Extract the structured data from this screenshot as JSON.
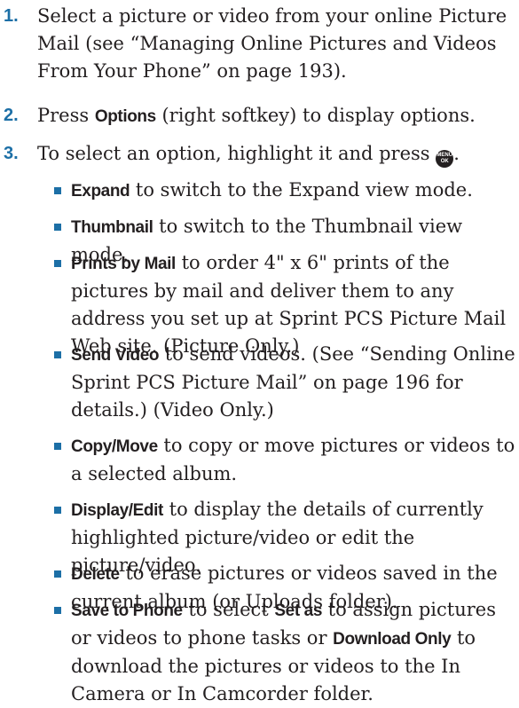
{
  "colors": {
    "accent": "#1c6fa6",
    "text": "#231f20"
  },
  "steps": [
    {
      "num": "1.",
      "text": "Select a picture or video from your online Picture Mail (see “Managing Online Pictures and Videos From Your Phone” on page 193)."
    },
    {
      "num": "2.",
      "bold": "Options",
      "rest": " (right softkey) to display options.",
      "pre": "Press "
    },
    {
      "num": "3.",
      "text": "To select an option, highlight it and press ",
      "key_icon": "menu-ok-key-icon",
      "key_top": "MENU",
      "key_bottom": "OK",
      "end": "."
    }
  ],
  "options": [
    {
      "bold": "Expand",
      "text": " to switch to the Expand view mode."
    },
    {
      "bold": "Thumbnail",
      "text": " to switch to the Thumbnail view mode."
    },
    {
      "bold": "Prints by Mail",
      "text": " to order 4\" x 6\" prints of the pictures by mail and deliver them to any address you set up at Sprint PCS Picture Mail Web site. (Picture Only.)"
    },
    {
      "bold": "Send Video",
      "text": " to send videos. (See “Sending Online Sprint PCS Picture Mail” on page 196 for details.) (Video Only.)"
    },
    {
      "bold": "Copy/Move",
      "text": " to copy or move pictures or videos to a selected album."
    },
    {
      "bold": "Display/Edit",
      "text": " to display the details of currently highlighted picture/video or edit the picture/video."
    },
    {
      "bold": "Delete",
      "text": " to erase pictures or videos saved in the current album (or Uploads folder)."
    },
    {
      "bold": "Save to Phone",
      "text": " to select ",
      "bold2": "Set as",
      "text2": " to assign pictures or videos to phone tasks or ",
      "bold3": "Download Only",
      "text3": " to download the pictures or videos to the In Camera or In Camcorder folder."
    }
  ]
}
